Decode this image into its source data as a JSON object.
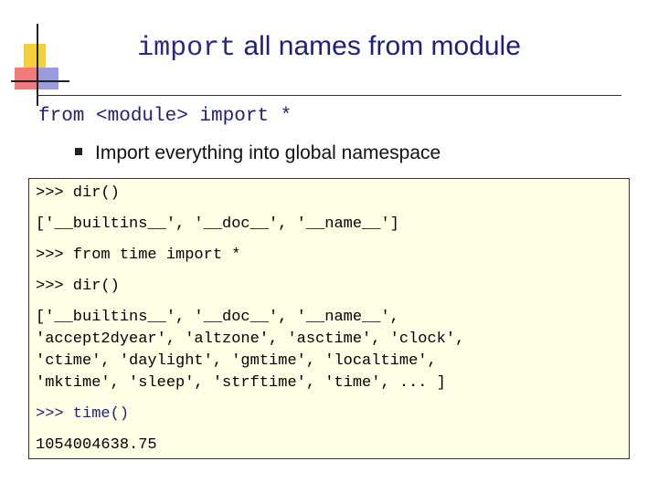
{
  "title": {
    "code_part": "import",
    "text_part": "all names from module"
  },
  "syntax": "from <module> import *",
  "bullet": "Import everything into global namespace",
  "console": {
    "lines": [
      ">>> dir()",
      "['__builtins__', '__doc__', '__name__']",
      ">>> from time import *",
      ">>> dir()",
      "['__builtins__', '__doc__', '__name__',",
      "'accept2dyear', 'altzone', 'asctime', 'clock',",
      "'ctime', 'daylight', 'gmtime', 'localtime',",
      "'mktime', 'sleep', 'strftime', 'time', ... ]",
      ">>> time()",
      "1054004638.75"
    ]
  }
}
